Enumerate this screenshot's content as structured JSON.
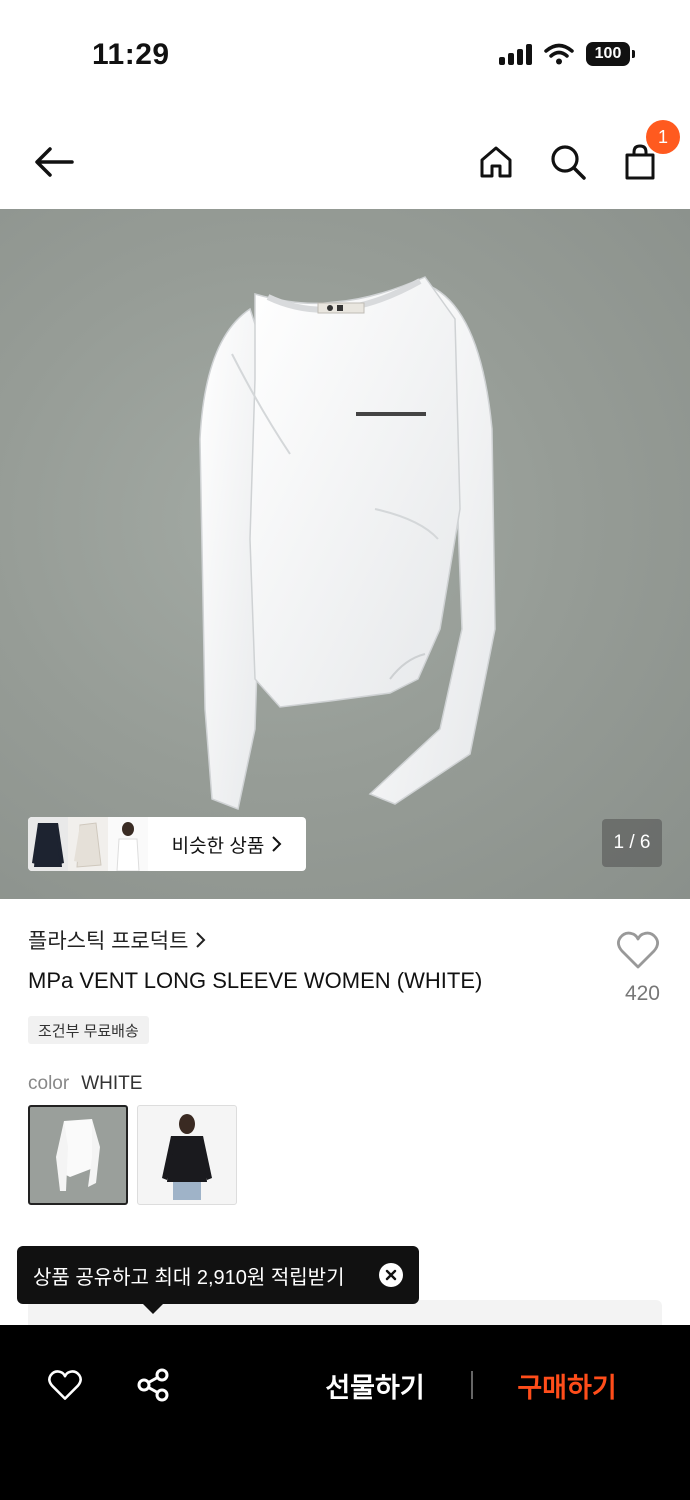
{
  "status_bar": {
    "time": "11:29",
    "battery": "100"
  },
  "header": {
    "cart_count": "1"
  },
  "gallery": {
    "similar_label": "비슷한 상품",
    "page_indicator": "1 / 6"
  },
  "product": {
    "brand": "플라스틱 프로덕트",
    "name": "MPa VENT LONG SLEEVE WOMEN (WHITE)",
    "likes": "420",
    "shipping_tag": "조건부 무료배송",
    "color_label": "color",
    "color_value": "WHITE"
  },
  "tooltip": {
    "text": "상품 공유하고 최대 2,910원 적립받기"
  },
  "bottom_bar": {
    "gift_label": "선물하기",
    "buy_label": "구매하기"
  },
  "colors": {
    "accent": "#ff5a1f",
    "buy": "#ff4d1a",
    "bar_bg": "#000000"
  }
}
